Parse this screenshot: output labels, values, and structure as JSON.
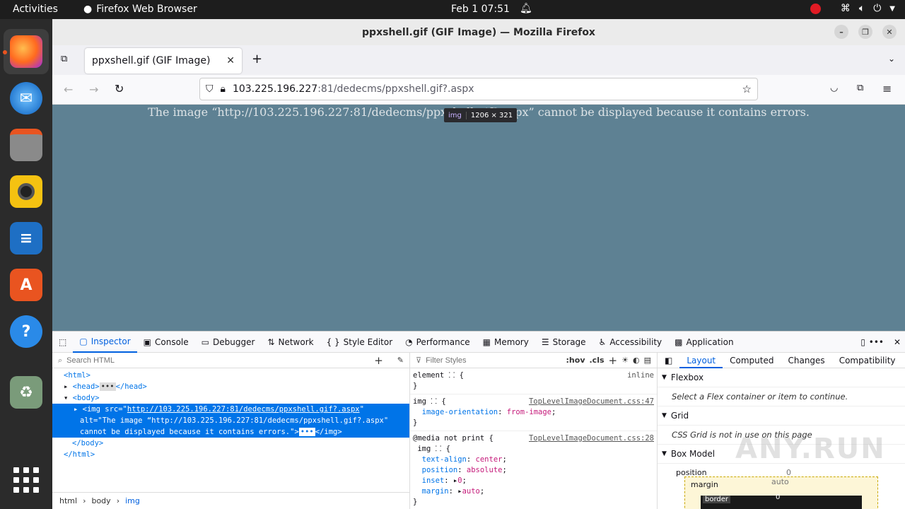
{
  "system": {
    "activities": "Activities",
    "app_name": "Firefox Web Browser",
    "clock": "Feb 1  07:51"
  },
  "window": {
    "title": "ppxshell.gif (GIF Image) — Mozilla Firefox"
  },
  "tab": {
    "title": "ppxshell.gif (GIF Image)"
  },
  "url": {
    "host": "103.225.196.227",
    "rest": ":81/dedecms/ppxshell.gif?.aspx"
  },
  "page": {
    "error": "The image “http://103.225.196.227:81/dedecms/ppxshell.gif?.aspx” cannot be displayed because it contains errors.",
    "tooltip_tag": "img",
    "tooltip_size": "1206 × 321"
  },
  "devtools": {
    "tabs": [
      "Inspector",
      "Console",
      "Debugger",
      "Network",
      "Style Editor",
      "Performance",
      "Memory",
      "Storage",
      "Accessibility",
      "Application"
    ],
    "search_html_placeholder": "Search HTML",
    "filter_styles_placeholder": "Filter Styles",
    "hov": ":hov",
    "cls": ".cls",
    "tree": {
      "html_open": "<html>",
      "head": "<head>",
      "head_close": "</head>",
      "body_open": "<body>",
      "img_line1_pre": "<img src=\"",
      "img_src": "http://103.225.196.227:81/dedecms/ppxshell.gif?.aspx",
      "img_line1_post": "\"",
      "img_line2": "alt=\"The image “http://103.225.196.227:81/dedecms/ppxshell.gif?.aspx\"",
      "img_line3": "cannot be displayed because it contains errors.\">",
      "img_close": "</img>",
      "body_close": "</body>",
      "html_close": "</html>"
    },
    "breadcrumb": [
      "html",
      "body",
      "img"
    ],
    "rules": {
      "r1_selector": "element",
      "r1_src": "inline",
      "r2_selector": "img",
      "r2_src": "TopLevelImageDocument.css:47",
      "r2_prop": "image-orientation",
      "r2_val": "from-image",
      "r3_media": "@media not print {",
      "r3_src": "TopLevelImageDocument.css:28",
      "r3_selector": "img",
      "p1": "text-align",
      "v1": "center",
      "p2": "position",
      "v2": "absolute",
      "p3": "inset",
      "v3": "0",
      "p4": "margin",
      "v4": "auto"
    },
    "layout_tabs": [
      "Layout",
      "Computed",
      "Changes",
      "Compatibility"
    ],
    "flexbox": "Flexbox",
    "flexbox_msg": "Select a Flex container or item to continue.",
    "grid": "Grid",
    "grid_msg": "CSS Grid is not in use on this page",
    "boxmodel": "Box Model",
    "position_label": "position",
    "position_val": "0",
    "margin_label": "margin",
    "margin_val": "auto",
    "border_label": "border",
    "border_val": "0"
  },
  "watermark": "ANY.RUN"
}
